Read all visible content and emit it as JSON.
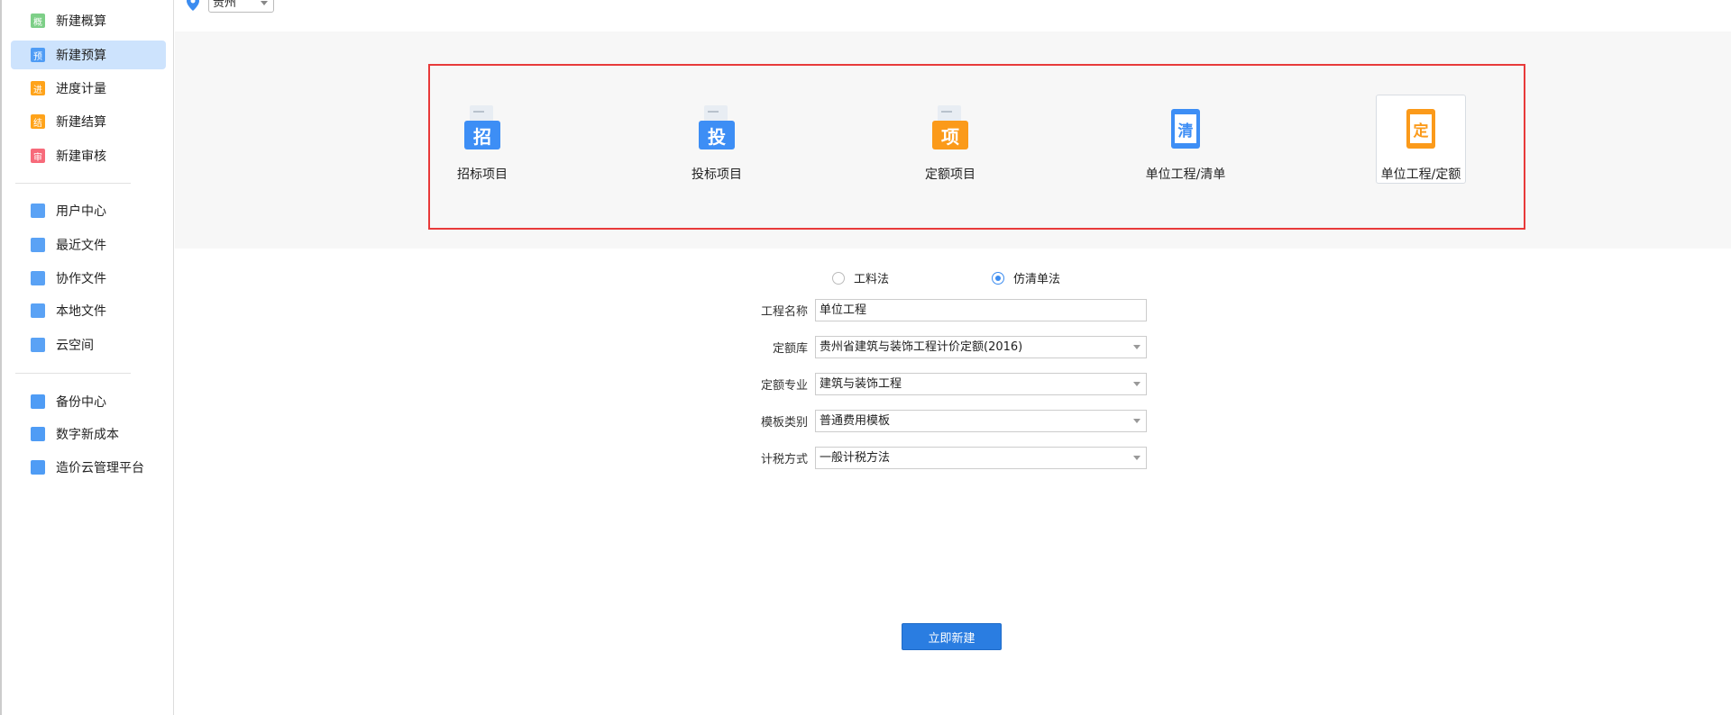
{
  "sidebar": {
    "group1": [
      {
        "label": "新建概算",
        "icon": "概",
        "color": "#7dcf87"
      },
      {
        "label": "新建预算",
        "icon": "预",
        "color": "#4f9cf5",
        "selected": true
      },
      {
        "label": "进度计量",
        "icon": "进",
        "color": "#ffa31a"
      },
      {
        "label": "新建结算",
        "icon": "结",
        "color": "#ffa31a"
      },
      {
        "label": "新建审核",
        "icon": "审",
        "color": "#f76a7a"
      }
    ],
    "group2": [
      {
        "label": "用户中心",
        "icon": "user-icon"
      },
      {
        "label": "最近文件",
        "icon": "recent-file-icon"
      },
      {
        "label": "协作文件",
        "icon": "collab-file-icon"
      },
      {
        "label": "本地文件",
        "icon": "local-file-icon"
      },
      {
        "label": "云空间",
        "icon": "cloud-space-icon"
      }
    ],
    "group3": [
      {
        "label": "备份中心",
        "icon": "backup-icon"
      },
      {
        "label": "数字新成本",
        "icon": "digital-cost-icon"
      },
      {
        "label": "造价云管理平台",
        "icon": "cloud-platform-icon"
      }
    ]
  },
  "topbar": {
    "region": "贵州",
    "location_icon": "map-pin-icon"
  },
  "project_types": [
    {
      "label": "招标项目",
      "glyph": "招",
      "color": "#3d8ef5",
      "style": "folder"
    },
    {
      "label": "投标项目",
      "glyph": "投",
      "color": "#3d8ef5",
      "style": "folder"
    },
    {
      "label": "定额项目",
      "glyph": "项",
      "color": "#fb9a1a",
      "style": "folder"
    },
    {
      "label": "单位工程/清单",
      "glyph": "清",
      "color": "#3d8ef5",
      "style": "note"
    },
    {
      "label": "单位工程/定额",
      "glyph": "定",
      "color": "#fb9a1a",
      "style": "note",
      "selected": true
    }
  ],
  "method": {
    "options": [
      "工料法",
      "仿清单法"
    ],
    "selected": "仿清单法"
  },
  "form": {
    "name_label": "工程名称",
    "name_value": "单位工程",
    "quota_lib_label": "定额库",
    "quota_lib_value": "贵州省建筑与装饰工程计价定额(2016)",
    "quota_major_label": "定额专业",
    "quota_major_value": "建筑与装饰工程",
    "template_label": "模板类别",
    "template_value": "普通费用模板",
    "tax_label": "计税方式",
    "tax_value": "一般计税方法"
  },
  "create_button": "立即新建",
  "colors": {
    "accent": "#2a7de1",
    "highlight_box": "#e83a3a",
    "selected_bg": "#cde3fd"
  }
}
